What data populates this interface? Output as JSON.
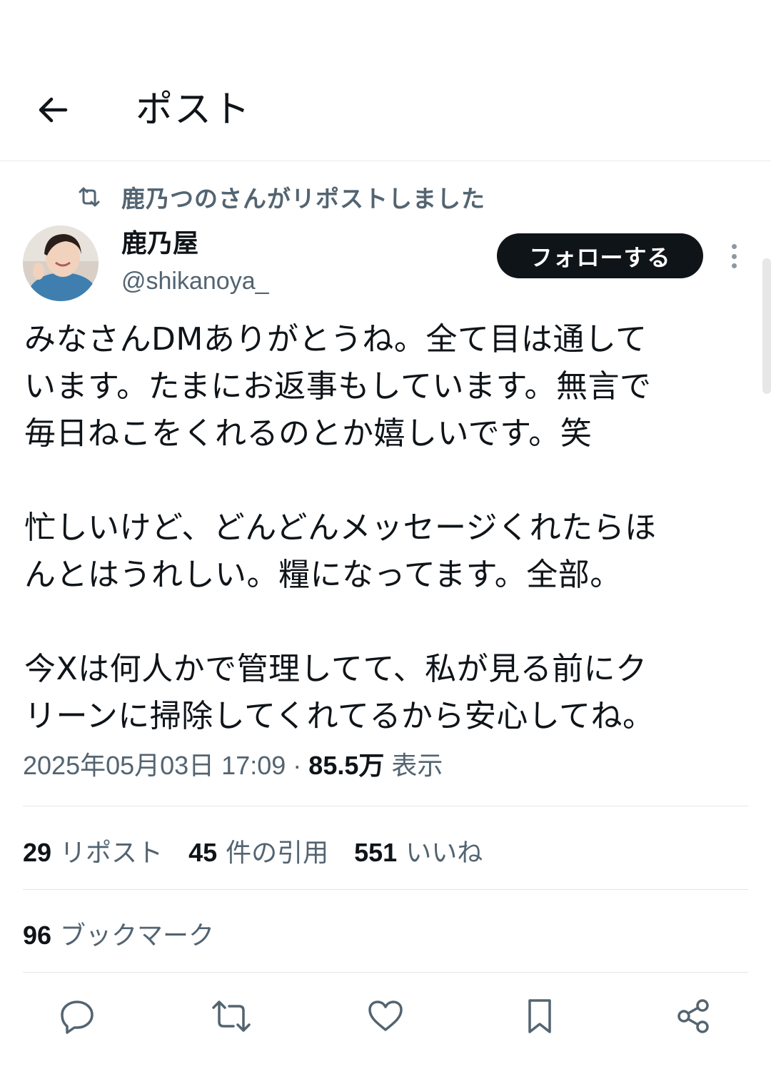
{
  "header": {
    "title": "ポスト"
  },
  "repost_notice": {
    "text": "鹿乃つのさんがリポストしました"
  },
  "author": {
    "display_name": "鹿乃屋",
    "handle": "@shikanoya_"
  },
  "follow_button": {
    "label": "フォローする"
  },
  "tweet": {
    "paragraphs": [
      [
        "みなさんDMありがとうね。全て目は通して",
        "います。たまにお返事もしています。無言で",
        "毎日ねこをくれるのとか嬉しいです。笑"
      ],
      [
        "忙しいけど、どんどんメッセージくれたらほ",
        "んとはうれしい。糧になってます。全部。"
      ],
      [
        "今Xは何人かで管理してて、私が見る前にク",
        "リーンに掃除してくれてるから安心してね。"
      ]
    ],
    "timestamp": "2025年05月03日 17:09",
    "separator": "·",
    "views_count": "85.5万",
    "views_label": "表示"
  },
  "stats": {
    "reposts_count": "29",
    "reposts_label": "リポスト",
    "quotes_count": "45",
    "quotes_label": "件の引用",
    "likes_count": "551",
    "likes_label": "いいね",
    "bookmarks_count": "96",
    "bookmarks_label": "ブックマーク"
  },
  "icons": {
    "back": "arrow-left-icon",
    "repost": "repost-icon",
    "more": "more-vertical-icon",
    "reply": "reply-icon",
    "retweet": "retweet-icon",
    "like": "heart-icon",
    "bookmark": "bookmark-icon",
    "share": "share-icon"
  },
  "colors": {
    "text_primary": "#0f1419",
    "text_secondary": "#536471",
    "divider": "#e1e6ea",
    "button_bg": "#0f1419",
    "button_text": "#ffffff"
  }
}
